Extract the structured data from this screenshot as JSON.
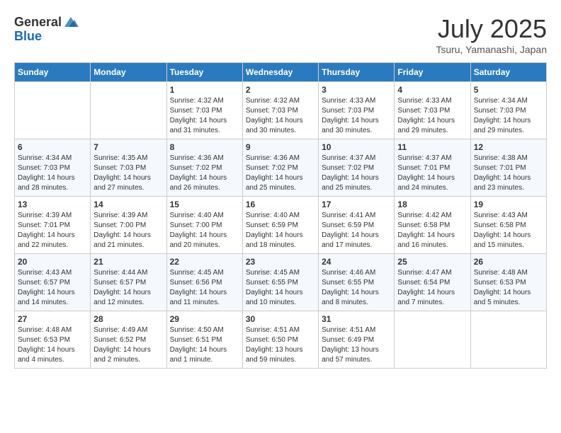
{
  "header": {
    "logo_general": "General",
    "logo_blue": "Blue",
    "month_title": "July 2025",
    "subtitle": "Tsuru, Yamanashi, Japan"
  },
  "weekdays": [
    "Sunday",
    "Monday",
    "Tuesday",
    "Wednesday",
    "Thursday",
    "Friday",
    "Saturday"
  ],
  "weeks": [
    [
      {
        "day": "",
        "sunrise": "",
        "sunset": "",
        "daylight": ""
      },
      {
        "day": "",
        "sunrise": "",
        "sunset": "",
        "daylight": ""
      },
      {
        "day": "1",
        "sunrise": "Sunrise: 4:32 AM",
        "sunset": "Sunset: 7:03 PM",
        "daylight": "Daylight: 14 hours and 31 minutes."
      },
      {
        "day": "2",
        "sunrise": "Sunrise: 4:32 AM",
        "sunset": "Sunset: 7:03 PM",
        "daylight": "Daylight: 14 hours and 30 minutes."
      },
      {
        "day": "3",
        "sunrise": "Sunrise: 4:33 AM",
        "sunset": "Sunset: 7:03 PM",
        "daylight": "Daylight: 14 hours and 30 minutes."
      },
      {
        "day": "4",
        "sunrise": "Sunrise: 4:33 AM",
        "sunset": "Sunset: 7:03 PM",
        "daylight": "Daylight: 14 hours and 29 minutes."
      },
      {
        "day": "5",
        "sunrise": "Sunrise: 4:34 AM",
        "sunset": "Sunset: 7:03 PM",
        "daylight": "Daylight: 14 hours and 29 minutes."
      }
    ],
    [
      {
        "day": "6",
        "sunrise": "Sunrise: 4:34 AM",
        "sunset": "Sunset: 7:03 PM",
        "daylight": "Daylight: 14 hours and 28 minutes."
      },
      {
        "day": "7",
        "sunrise": "Sunrise: 4:35 AM",
        "sunset": "Sunset: 7:03 PM",
        "daylight": "Daylight: 14 hours and 27 minutes."
      },
      {
        "day": "8",
        "sunrise": "Sunrise: 4:36 AM",
        "sunset": "Sunset: 7:02 PM",
        "daylight": "Daylight: 14 hours and 26 minutes."
      },
      {
        "day": "9",
        "sunrise": "Sunrise: 4:36 AM",
        "sunset": "Sunset: 7:02 PM",
        "daylight": "Daylight: 14 hours and 25 minutes."
      },
      {
        "day": "10",
        "sunrise": "Sunrise: 4:37 AM",
        "sunset": "Sunset: 7:02 PM",
        "daylight": "Daylight: 14 hours and 25 minutes."
      },
      {
        "day": "11",
        "sunrise": "Sunrise: 4:37 AM",
        "sunset": "Sunset: 7:01 PM",
        "daylight": "Daylight: 14 hours and 24 minutes."
      },
      {
        "day": "12",
        "sunrise": "Sunrise: 4:38 AM",
        "sunset": "Sunset: 7:01 PM",
        "daylight": "Daylight: 14 hours and 23 minutes."
      }
    ],
    [
      {
        "day": "13",
        "sunrise": "Sunrise: 4:39 AM",
        "sunset": "Sunset: 7:01 PM",
        "daylight": "Daylight: 14 hours and 22 minutes."
      },
      {
        "day": "14",
        "sunrise": "Sunrise: 4:39 AM",
        "sunset": "Sunset: 7:00 PM",
        "daylight": "Daylight: 14 hours and 21 minutes."
      },
      {
        "day": "15",
        "sunrise": "Sunrise: 4:40 AM",
        "sunset": "Sunset: 7:00 PM",
        "daylight": "Daylight: 14 hours and 20 minutes."
      },
      {
        "day": "16",
        "sunrise": "Sunrise: 4:40 AM",
        "sunset": "Sunset: 6:59 PM",
        "daylight": "Daylight: 14 hours and 18 minutes."
      },
      {
        "day": "17",
        "sunrise": "Sunrise: 4:41 AM",
        "sunset": "Sunset: 6:59 PM",
        "daylight": "Daylight: 14 hours and 17 minutes."
      },
      {
        "day": "18",
        "sunrise": "Sunrise: 4:42 AM",
        "sunset": "Sunset: 6:58 PM",
        "daylight": "Daylight: 14 hours and 16 minutes."
      },
      {
        "day": "19",
        "sunrise": "Sunrise: 4:43 AM",
        "sunset": "Sunset: 6:58 PM",
        "daylight": "Daylight: 14 hours and 15 minutes."
      }
    ],
    [
      {
        "day": "20",
        "sunrise": "Sunrise: 4:43 AM",
        "sunset": "Sunset: 6:57 PM",
        "daylight": "Daylight: 14 hours and 14 minutes."
      },
      {
        "day": "21",
        "sunrise": "Sunrise: 4:44 AM",
        "sunset": "Sunset: 6:57 PM",
        "daylight": "Daylight: 14 hours and 12 minutes."
      },
      {
        "day": "22",
        "sunrise": "Sunrise: 4:45 AM",
        "sunset": "Sunset: 6:56 PM",
        "daylight": "Daylight: 14 hours and 11 minutes."
      },
      {
        "day": "23",
        "sunrise": "Sunrise: 4:45 AM",
        "sunset": "Sunset: 6:55 PM",
        "daylight": "Daylight: 14 hours and 10 minutes."
      },
      {
        "day": "24",
        "sunrise": "Sunrise: 4:46 AM",
        "sunset": "Sunset: 6:55 PM",
        "daylight": "Daylight: 14 hours and 8 minutes."
      },
      {
        "day": "25",
        "sunrise": "Sunrise: 4:47 AM",
        "sunset": "Sunset: 6:54 PM",
        "daylight": "Daylight: 14 hours and 7 minutes."
      },
      {
        "day": "26",
        "sunrise": "Sunrise: 4:48 AM",
        "sunset": "Sunset: 6:53 PM",
        "daylight": "Daylight: 14 hours and 5 minutes."
      }
    ],
    [
      {
        "day": "27",
        "sunrise": "Sunrise: 4:48 AM",
        "sunset": "Sunset: 6:53 PM",
        "daylight": "Daylight: 14 hours and 4 minutes."
      },
      {
        "day": "28",
        "sunrise": "Sunrise: 4:49 AM",
        "sunset": "Sunset: 6:52 PM",
        "daylight": "Daylight: 14 hours and 2 minutes."
      },
      {
        "day": "29",
        "sunrise": "Sunrise: 4:50 AM",
        "sunset": "Sunset: 6:51 PM",
        "daylight": "Daylight: 14 hours and 1 minute."
      },
      {
        "day": "30",
        "sunrise": "Sunrise: 4:51 AM",
        "sunset": "Sunset: 6:50 PM",
        "daylight": "Daylight: 13 hours and 59 minutes."
      },
      {
        "day": "31",
        "sunrise": "Sunrise: 4:51 AM",
        "sunset": "Sunset: 6:49 PM",
        "daylight": "Daylight: 13 hours and 57 minutes."
      },
      {
        "day": "",
        "sunrise": "",
        "sunset": "",
        "daylight": ""
      },
      {
        "day": "",
        "sunrise": "",
        "sunset": "",
        "daylight": ""
      }
    ]
  ]
}
